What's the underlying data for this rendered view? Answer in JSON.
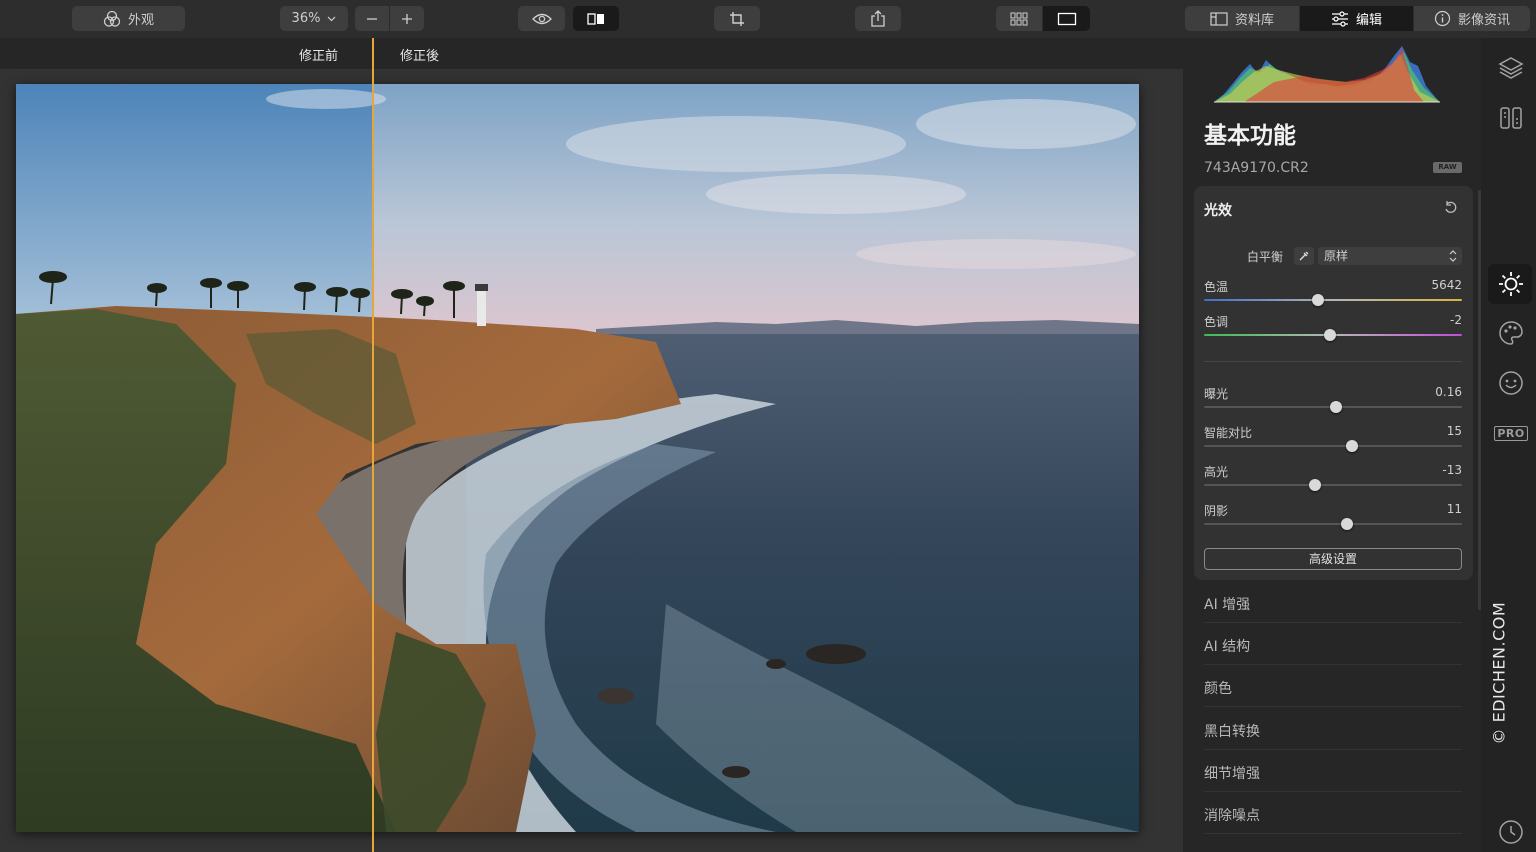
{
  "toolbar": {
    "appearance_label": "外观",
    "zoom_value": "36%",
    "library_label": "资料库",
    "edit_label": "编辑",
    "info_label": "影像资讯"
  },
  "compare": {
    "before_label": "修正前",
    "after_label": "修正後"
  },
  "panel": {
    "title": "基本功能",
    "file_name": "743A9170.CR2",
    "raw_badge": "RAW",
    "section": {
      "title": "光效",
      "white_balance_label": "白平衡",
      "white_balance_value": "原样",
      "sliders": [
        {
          "label": "色温",
          "value": "5642",
          "position": 0.44
        },
        {
          "label": "色调",
          "value": "-2",
          "position": 0.49
        },
        {
          "label": "曝光",
          "value": "0.16",
          "position": 0.51
        },
        {
          "label": "智能对比",
          "value": "15",
          "position": 0.575
        },
        {
          "label": "高光",
          "value": "-13",
          "position": 0.43
        },
        {
          "label": "阴影",
          "value": "11",
          "position": 0.555
        }
      ],
      "advanced_label": "高级设置"
    },
    "tools": [
      "AI 增强",
      "AI 结构",
      "颜色",
      "黑白转换",
      "细节增强",
      "消除噪点"
    ]
  },
  "rail": {
    "icons": [
      "layers-icon",
      "compare-panels-icon",
      "sun-icon",
      "palette-icon",
      "smiley-icon",
      "pro-icon",
      "history-clock-icon"
    ],
    "pro_label": "PRO"
  },
  "watermark": "© EDICHEN.COM",
  "colors": {
    "accent_split": "#e6a73a",
    "toolbar_bg": "#2d2d2d",
    "panel_bg": "#262626",
    "section_bg": "#323232"
  }
}
